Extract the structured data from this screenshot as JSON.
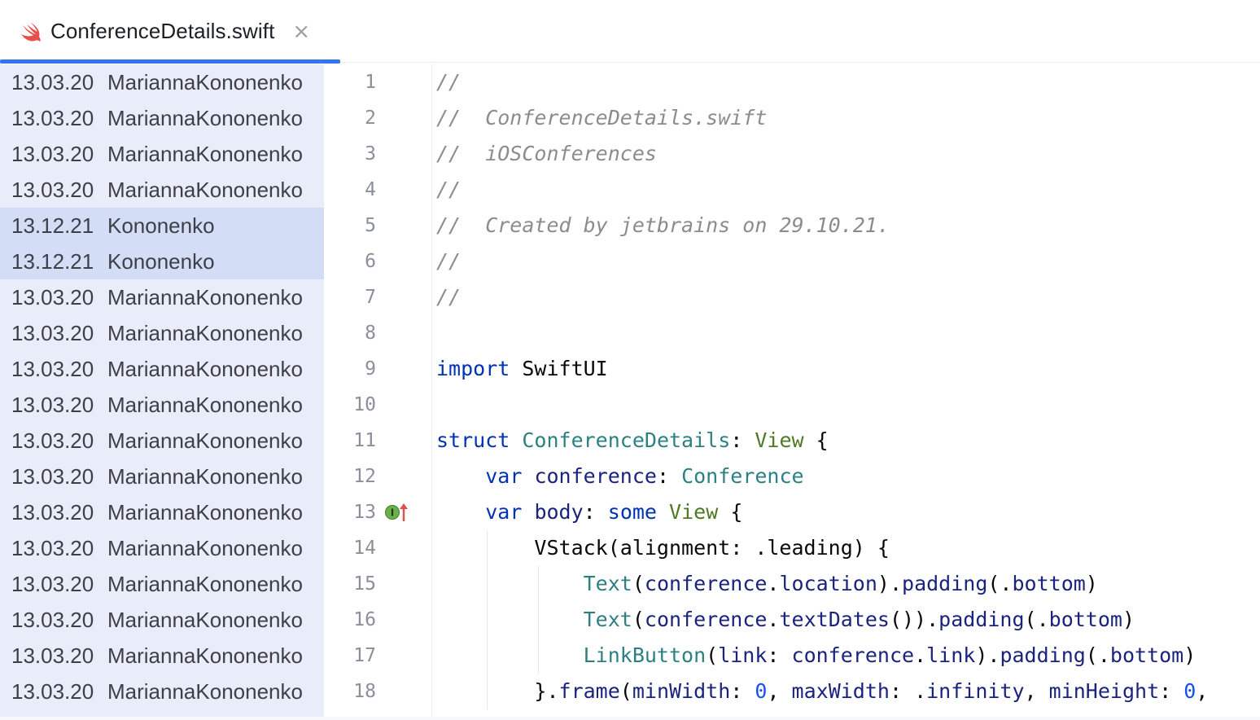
{
  "tab": {
    "icon": "swift-file-icon",
    "title": "ConferenceDetails.swift",
    "close_glyph": "×",
    "accent_color": "#3574f0"
  },
  "blame": [
    {
      "date": "13.03.20",
      "author": "MariannaKononenko",
      "highlight": false
    },
    {
      "date": "13.03.20",
      "author": "MariannaKononenko",
      "highlight": false
    },
    {
      "date": "13.03.20",
      "author": "MariannaKononenko",
      "highlight": false
    },
    {
      "date": "13.03.20",
      "author": "MariannaKononenko",
      "highlight": false
    },
    {
      "date": "13.12.21",
      "author": "Kononenko",
      "highlight": true
    },
    {
      "date": "13.12.21",
      "author": "Kononenko",
      "highlight": true
    },
    {
      "date": "13.03.20",
      "author": "MariannaKononenko",
      "highlight": false
    },
    {
      "date": "13.03.20",
      "author": "MariannaKononenko",
      "highlight": false
    },
    {
      "date": "13.03.20",
      "author": "MariannaKononenko",
      "highlight": false
    },
    {
      "date": "13.03.20",
      "author": "MariannaKononenko",
      "highlight": false
    },
    {
      "date": "13.03.20",
      "author": "MariannaKononenko",
      "highlight": false
    },
    {
      "date": "13.03.20",
      "author": "MariannaKononenko",
      "highlight": false
    },
    {
      "date": "13.03.20",
      "author": "MariannaKononenko",
      "highlight": false
    },
    {
      "date": "13.03.20",
      "author": "MariannaKononenko",
      "highlight": false
    },
    {
      "date": "13.03.20",
      "author": "MariannaKononenko",
      "highlight": false
    },
    {
      "date": "13.03.20",
      "author": "MariannaKononenko",
      "highlight": false
    },
    {
      "date": "13.03.20",
      "author": "MariannaKononenko",
      "highlight": false
    },
    {
      "date": "13.03.20",
      "author": "MariannaKononenko",
      "highlight": false
    }
  ],
  "line_numbers": [
    "1",
    "2",
    "3",
    "4",
    "5",
    "6",
    "7",
    "8",
    "9",
    "10",
    "11",
    "12",
    "13",
    "14",
    "15",
    "16",
    "17",
    "18"
  ],
  "gutter_icon": {
    "line": 13,
    "icon": "implements-protocol-icon"
  },
  "code": [
    [
      {
        "t": "//",
        "c": "cm"
      }
    ],
    [
      {
        "t": "//  ConferenceDetails.swift",
        "c": "cm"
      }
    ],
    [
      {
        "t": "//  iOSConferences",
        "c": "cm"
      }
    ],
    [
      {
        "t": "//",
        "c": "cm"
      }
    ],
    [
      {
        "t": "//  Created by jetbrains on 29.10.21.",
        "c": "cm"
      }
    ],
    [
      {
        "t": "//",
        "c": "cm"
      }
    ],
    [
      {
        "t": "//",
        "c": "cm"
      }
    ],
    [],
    [
      {
        "t": "import",
        "c": "kw"
      },
      {
        "t": " SwiftUI",
        "c": ""
      }
    ],
    [],
    [
      {
        "t": "struct",
        "c": "kw"
      },
      {
        "t": " ",
        "c": ""
      },
      {
        "t": "ConferenceDetails",
        "c": "ty"
      },
      {
        "t": ": ",
        "c": ""
      },
      {
        "t": "View",
        "c": "ty2"
      },
      {
        "t": " {",
        "c": ""
      }
    ],
    [
      {
        "t": "    ",
        "c": ""
      },
      {
        "t": "var",
        "c": "kw"
      },
      {
        "t": " ",
        "c": ""
      },
      {
        "t": "conference",
        "c": "prop"
      },
      {
        "t": ": ",
        "c": ""
      },
      {
        "t": "Conference",
        "c": "ty"
      }
    ],
    [
      {
        "t": "    ",
        "c": ""
      },
      {
        "t": "var",
        "c": "kw"
      },
      {
        "t": " ",
        "c": ""
      },
      {
        "t": "body",
        "c": "prop"
      },
      {
        "t": ": ",
        "c": ""
      },
      {
        "t": "some",
        "c": "kw"
      },
      {
        "t": " ",
        "c": ""
      },
      {
        "t": "View",
        "c": "ty2"
      },
      {
        "t": " {",
        "c": ""
      }
    ],
    [
      {
        "t": "        VStack(alignment: .leading) {",
        "c": ""
      }
    ],
    [
      {
        "t": "            ",
        "c": ""
      },
      {
        "t": "Text",
        "c": "ty"
      },
      {
        "t": "(",
        "c": ""
      },
      {
        "t": "conference",
        "c": "prop"
      },
      {
        "t": ".",
        "c": ""
      },
      {
        "t": "location",
        "c": "prop"
      },
      {
        "t": ").",
        "c": ""
      },
      {
        "t": "padding",
        "c": "prop"
      },
      {
        "t": "(.",
        "c": ""
      },
      {
        "t": "bottom",
        "c": "prop"
      },
      {
        "t": ")",
        "c": ""
      }
    ],
    [
      {
        "t": "            ",
        "c": ""
      },
      {
        "t": "Text",
        "c": "ty"
      },
      {
        "t": "(",
        "c": ""
      },
      {
        "t": "conference",
        "c": "prop"
      },
      {
        "t": ".",
        "c": ""
      },
      {
        "t": "textDates",
        "c": "prop"
      },
      {
        "t": "()).",
        "c": ""
      },
      {
        "t": "padding",
        "c": "prop"
      },
      {
        "t": "(.",
        "c": ""
      },
      {
        "t": "bottom",
        "c": "prop"
      },
      {
        "t": ")",
        "c": ""
      }
    ],
    [
      {
        "t": "            ",
        "c": ""
      },
      {
        "t": "LinkButton",
        "c": "ty"
      },
      {
        "t": "(",
        "c": ""
      },
      {
        "t": "link",
        "c": "prop"
      },
      {
        "t": ": ",
        "c": ""
      },
      {
        "t": "conference",
        "c": "prop"
      },
      {
        "t": ".",
        "c": ""
      },
      {
        "t": "link",
        "c": "prop"
      },
      {
        "t": ").",
        "c": ""
      },
      {
        "t": "padding",
        "c": "prop"
      },
      {
        "t": "(.",
        "c": ""
      },
      {
        "t": "bottom",
        "c": "prop"
      },
      {
        "t": ")",
        "c": ""
      }
    ],
    [
      {
        "t": "        }.",
        "c": ""
      },
      {
        "t": "frame",
        "c": "prop"
      },
      {
        "t": "(",
        "c": ""
      },
      {
        "t": "minWidth",
        "c": "prop"
      },
      {
        "t": ": ",
        "c": ""
      },
      {
        "t": "0",
        "c": "num"
      },
      {
        "t": ", ",
        "c": ""
      },
      {
        "t": "maxWidth",
        "c": "prop"
      },
      {
        "t": ": .",
        "c": ""
      },
      {
        "t": "infinity",
        "c": "prop"
      },
      {
        "t": ", ",
        "c": ""
      },
      {
        "t": "minHeight",
        "c": "prop"
      },
      {
        "t": ": ",
        "c": ""
      },
      {
        "t": "0",
        "c": "num"
      },
      {
        "t": ",",
        "c": ""
      }
    ]
  ]
}
